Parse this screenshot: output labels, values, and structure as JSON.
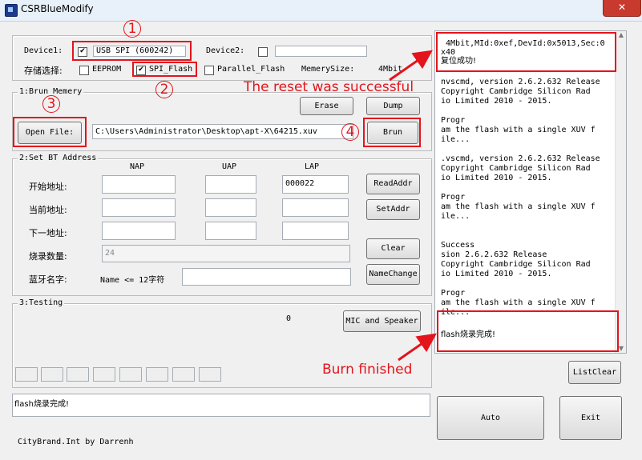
{
  "window": {
    "title": "CSRBlueModify",
    "close_symbol": "✕"
  },
  "device": {
    "device1_label": "Device1:",
    "device1_value": "USB SPI (600242)",
    "device2_label": "Device2:",
    "storage_label": "存储选择:",
    "eeprom_label": "EEPROM",
    "spi_flash_label": "SPI_Flash",
    "parallel_flash_label": "Parallel_Flash",
    "memory_size_label": "MemerySize:",
    "memory_size_value": "4Mbit"
  },
  "burn": {
    "legend": "1:Brun Memery",
    "erase_label": "Erase",
    "dump_label": "Dump",
    "open_file_label": "Open File:",
    "file_path": "C:\\Users\\Administrator\\Desktop\\apt-X\\64215.xuv",
    "burn_label": "Brun"
  },
  "bt_address": {
    "legend": "2:Set BT Address",
    "col_nap": "NAP",
    "col_uap": "UAP",
    "col_lap": "LAP",
    "row_start": "开始地址:",
    "row_current": "当前地址:",
    "row_next": "下一地址:",
    "row_count": "烧录数量:",
    "row_name": "蓝牙名字:",
    "start_lap_value": "000022",
    "count_value": "24",
    "name_hint": "Name <= 12字符",
    "read_addr_label": "ReadAddr",
    "set_addr_label": "SetAddr",
    "clear_label": "Clear",
    "name_change_label": "NameChange"
  },
  "testing": {
    "legend": "3:Testing",
    "count_value": "0",
    "mic_speaker_label": "MIC and Speaker"
  },
  "status": {
    "message": "flash烧录完成!"
  },
  "footer": {
    "credit": "CityBrand.Int by Darrenh"
  },
  "right_panel": {
    "log_top_line1": " 4Mbit,MId:0xef,DevId:0x5013,Sec:0",
    "log_top_line2": "x40",
    "log_top_line3": "复位成功!",
    "log_body": "nvscmd, version 2.6.2.632 Release\nCopyright Cambridge Silicon Rad\nio Limited 2010 - 2015.\n\nProgr\nam the flash with a single XUV f\nile...\n\n.vscmd, version 2.6.2.632 Release\nCopyright Cambridge Silicon Rad\nio Limited 2010 - 2015.\n\nProgr\nam the flash with a single XUV f\nile...\n\n\nSuccess\nsion 2.6.2.632 Release\nCopyright Cambridge Silicon Rad\nio Limited 2010 - 2015.\n\nProgr\nam the flash with a single XUV f\nile...",
    "log_last_line": "flash烧录完成!",
    "list_clear_label": "ListClear",
    "auto_label": "Auto",
    "exit_label": "Exit"
  },
  "annotations": {
    "num1": "1",
    "num2": "2",
    "num3": "3",
    "num4": "4",
    "reset_success": "The reset was successful",
    "burn_finished": "Burn finished",
    "color": "#e3141c"
  }
}
